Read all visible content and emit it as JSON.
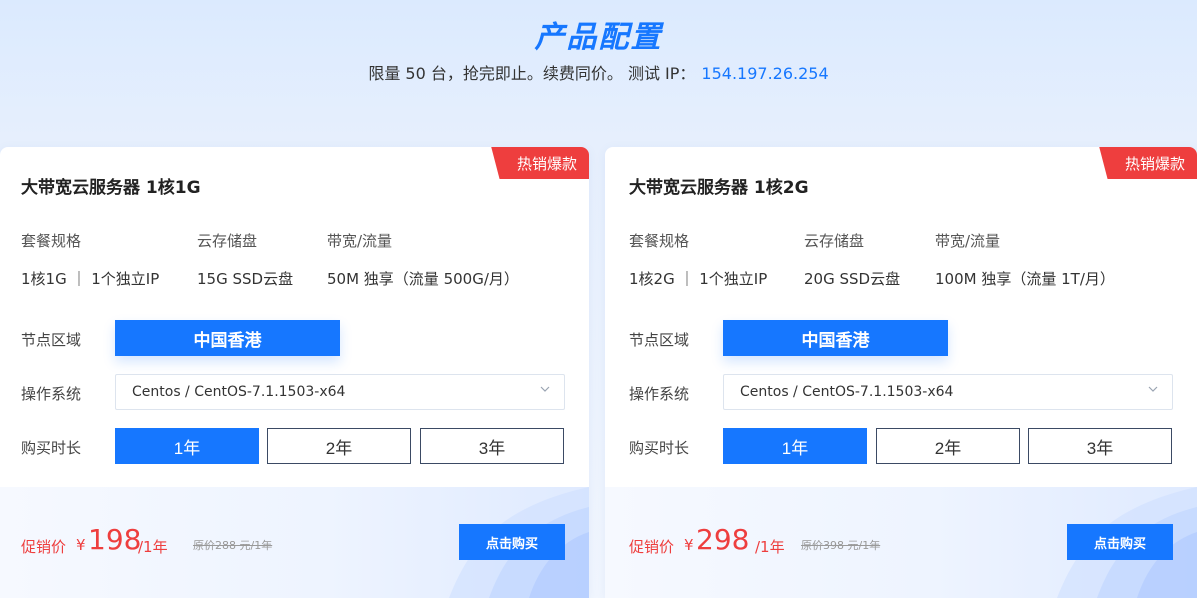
{
  "header": {
    "title": "产品配置",
    "subtitle": "限量 50 台，抢完即止。续费同价。 测试 IP：",
    "test_ip": "154.197.26.254"
  },
  "colors": {
    "accent": "#1677ff",
    "hot": "#ee3e3e",
    "price": "#ee3e3e"
  },
  "cards": [
    {
      "badge": "热销爆款",
      "title": "大带宽云服务器 1核1G",
      "specs": {
        "headers": [
          "套餐规格",
          "云存储盘",
          "带宽/流量"
        ],
        "values": [
          "1核1G ｜ 1个独立IP",
          "15G SSD云盘",
          "50M 独享（流量 500G/月）"
        ]
      },
      "region_label": "节点区域",
      "region": "中国香港",
      "os_label": "操作系统",
      "os_value": "Centos / CentOS-7.1.1503-x64",
      "duration_label": "购买时长",
      "durations": [
        "1年",
        "2年",
        "3年"
      ],
      "selected_duration": "1年",
      "price_label": "促销价",
      "currency": "¥",
      "price": "198",
      "period": "/1年",
      "original_price": "原价288 元/1年",
      "buy_label": "点击购买"
    },
    {
      "badge": "热销爆款",
      "title": "大带宽云服务器 1核2G",
      "specs": {
        "headers": [
          "套餐规格",
          "云存储盘",
          "带宽/流量"
        ],
        "values": [
          "1核2G ｜ 1个独立IP",
          "20G SSD云盘",
          "100M 独享（流量 1T/月）"
        ]
      },
      "region_label": "节点区域",
      "region": "中国香港",
      "os_label": "操作系统",
      "os_value": "Centos / CentOS-7.1.1503-x64",
      "duration_label": "购买时长",
      "durations": [
        "1年",
        "2年",
        "3年"
      ],
      "selected_duration": "1年",
      "price_label": "促销价",
      "currency": "¥",
      "price": "298",
      "period": "/1年",
      "original_price": "原价398 元/1年",
      "buy_label": "点击购买"
    }
  ]
}
